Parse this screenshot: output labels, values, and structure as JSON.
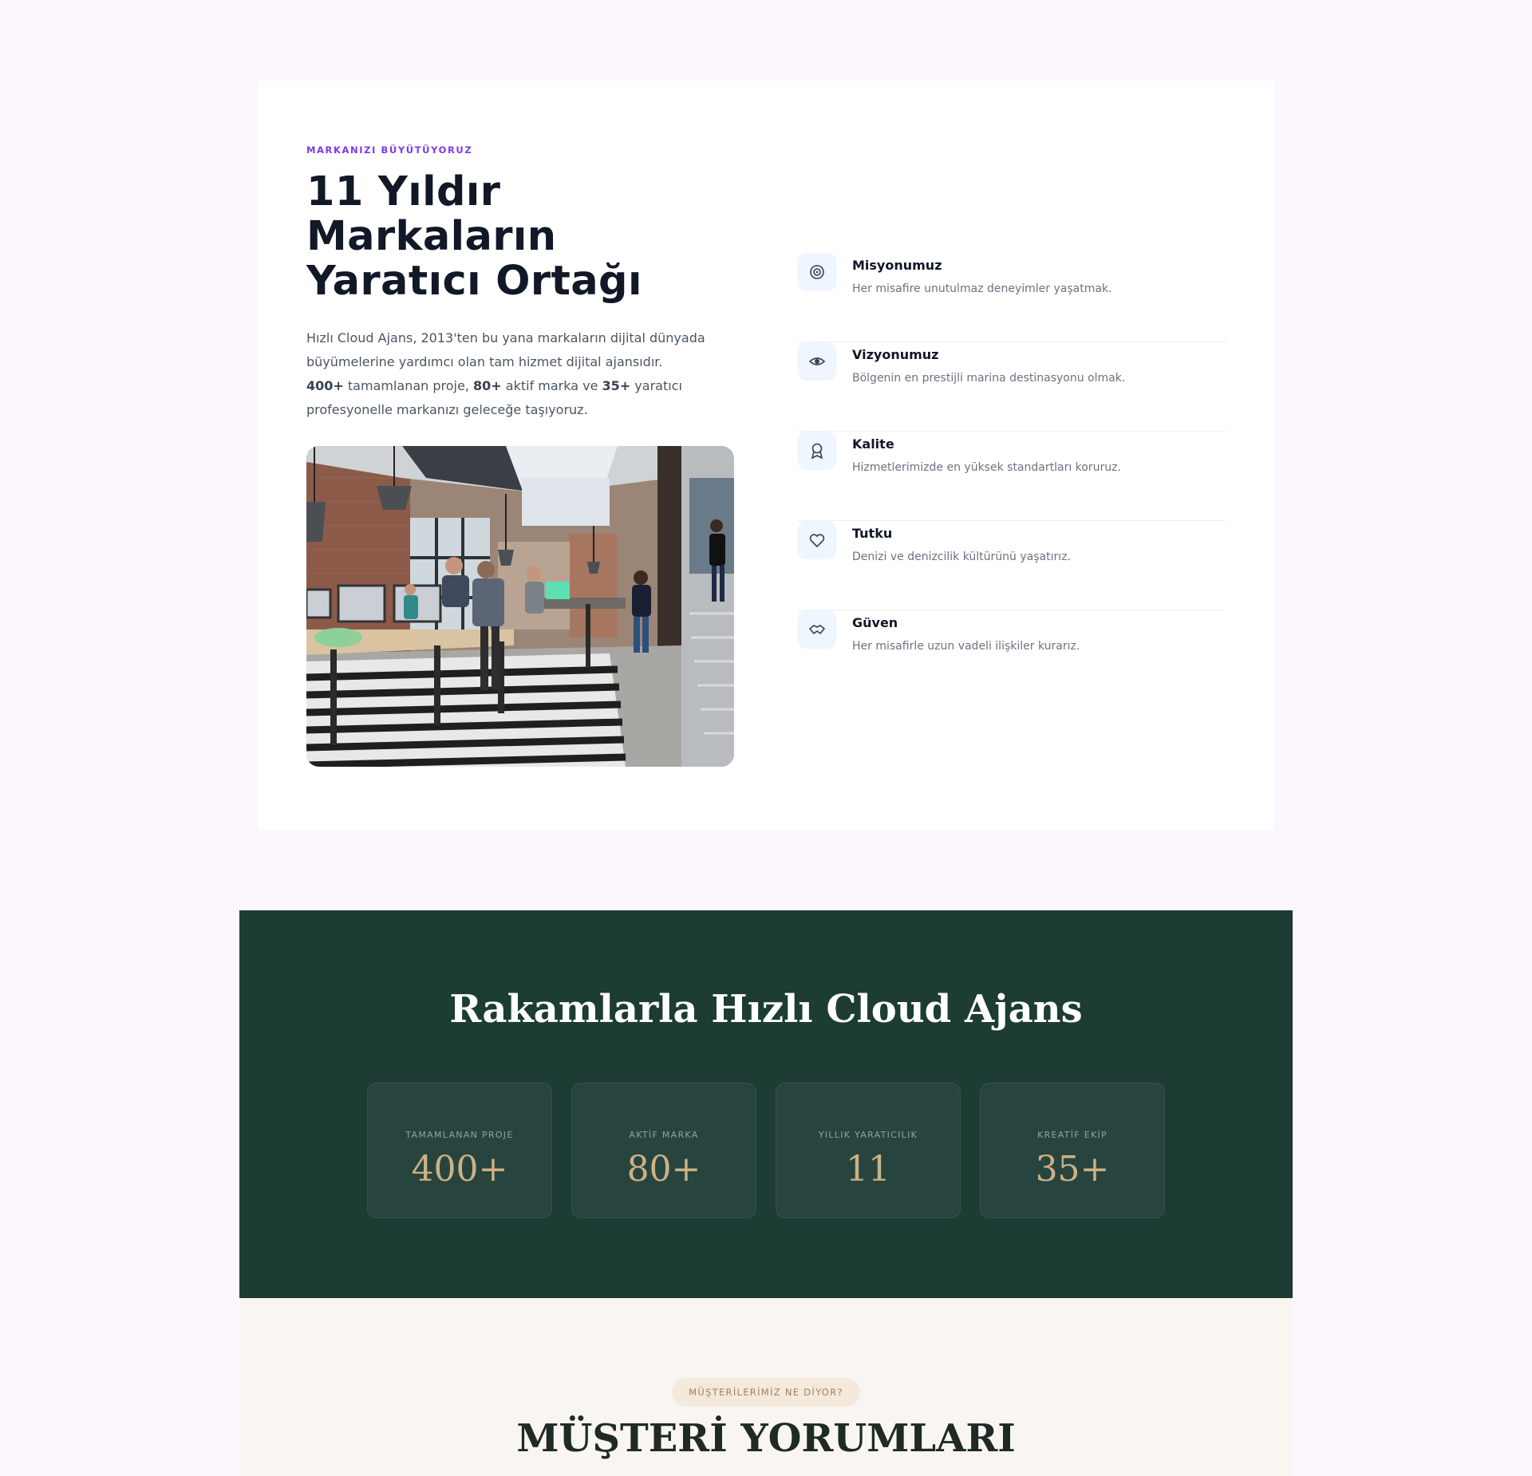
{
  "about": {
    "eyebrow": "MARKANIZI BÜYÜTÜYORUZ",
    "headline": "11 Yıldır Markaların Yaratıcı Ortağı",
    "intro_line1": "Hızlı Cloud Ajans, 2013'ten bu yana markaların dijital dünyada büyümelerine yardımcı olan tam hizmet dijital ajansıdır.",
    "stat_projects": "400+",
    "text_projects": " tamamlanan proje, ",
    "stat_brands": "80+",
    "text_brands": " aktif marka ve ",
    "stat_team": "35+",
    "text_team": " yaratıcı profesyonelle markanızı geleceğe taşıyoruz."
  },
  "values": [
    {
      "title": "Misyonumuz",
      "desc": "Her misafire unutulmaz deneyimler yaşatmak.",
      "icon": "target-icon"
    },
    {
      "title": "Vizyonumuz",
      "desc": "Bölgenin en prestijli marina destinasyonu olmak.",
      "icon": "eye-icon"
    },
    {
      "title": "Kalite",
      "desc": "Hizmetlerimizde en yüksek standartları koruruz.",
      "icon": "award-icon"
    },
    {
      "title": "Tutku",
      "desc": "Denizi ve denizcilik kültürünü yaşatırız.",
      "icon": "heart-icon"
    },
    {
      "title": "Güven",
      "desc": "Her misafirle uzun vadeli ilişkiler kurarız.",
      "icon": "handshake-icon"
    }
  ],
  "stats": {
    "title": "Rakamlarla Hızlı Cloud Ajans",
    "items": [
      {
        "label": "TAMAMLANAN PROJE",
        "value": "400+"
      },
      {
        "label": "AKTİF MARKA",
        "value": "80+"
      },
      {
        "label": "YILLIK YARATICILIK",
        "value": "11"
      },
      {
        "label": "KREATİF EKİP",
        "value": "35+"
      }
    ]
  },
  "testimonials": {
    "pill": "MÜŞTERİLERİMİZ NE DİYOR?",
    "title": "MÜŞTERİ YORUMLARI"
  },
  "colors": {
    "accent": "#7c3aed",
    "stats_bg": "#1c3c34",
    "stat_gold": "#cdb184",
    "testimonials_bg": "#f9f6f1"
  }
}
